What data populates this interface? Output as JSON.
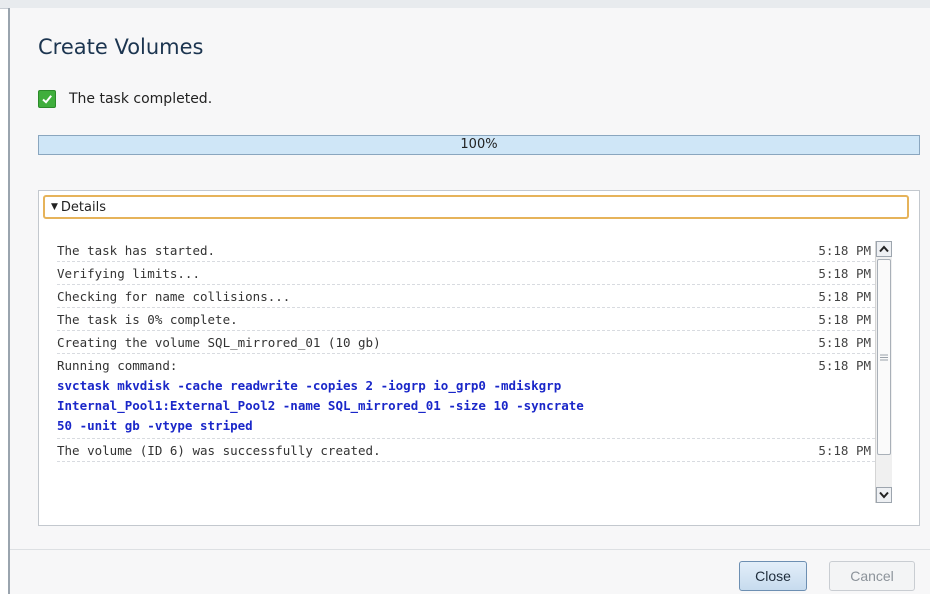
{
  "dialog": {
    "title": "Create Volumes",
    "status_text": "The task completed.",
    "progress": {
      "value": 1.0,
      "label": "100%"
    },
    "details_title": "Details",
    "log": [
      {
        "text": "The task has started.",
        "time": "5:18 PM"
      },
      {
        "text": "Verifying limits...",
        "time": "5:18 PM"
      },
      {
        "text": "Checking for name collisions...",
        "time": "5:18 PM"
      },
      {
        "text": "The task is 0% complete.",
        "time": "5:18 PM"
      },
      {
        "text": "Creating the volume SQL_mirrored_01 (10 gb)",
        "time": "5:18 PM"
      },
      {
        "text": "Running command:",
        "time": "5:18 PM"
      }
    ],
    "command": "svctask mkvdisk -cache readwrite -copies 2 -iogrp io_grp0 -mdiskgrp\nInternal_Pool1:External_Pool2 -name SQL_mirrored_01 -size 10 -syncrate\n50 -unit gb -vtype striped",
    "final_log": {
      "text": "The volume (ID 6) was successfully created.",
      "time": "5:18 PM"
    },
    "buttons": {
      "close": "Close",
      "cancel": "Cancel"
    }
  },
  "icons": {
    "status": "check-icon",
    "expand": "caret-down-icon",
    "scroll_up": "chevron-up-icon",
    "scroll_down": "chevron-down-icon"
  },
  "colors": {
    "success": "#3fae3c",
    "command_text": "#1a27c9",
    "focus_border": "#e6b35a",
    "progress_fill": "#cfe6f7"
  }
}
